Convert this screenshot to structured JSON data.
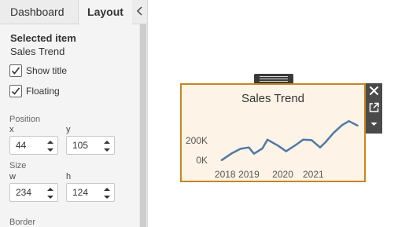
{
  "tabs": {
    "dashboard": "Dashboard",
    "layout": "Layout"
  },
  "selected": {
    "heading": "Selected item",
    "value": "Sales Trend"
  },
  "checkboxes": {
    "show_title": {
      "label": "Show title",
      "checked": true
    },
    "floating": {
      "label": "Floating",
      "checked": true
    }
  },
  "position": {
    "label": "Position",
    "x_label": "x",
    "x_value": "44",
    "y_label": "y",
    "y_value": "105"
  },
  "size": {
    "label": "Size",
    "w_label": "w",
    "w_value": "234",
    "h_label": "h",
    "h_value": "124"
  },
  "border": {
    "label": "Border"
  },
  "worksheet": {
    "title": "Sales Trend",
    "accent_color": "#c8851f",
    "background_color": "#fdf3e7"
  },
  "icons": {
    "collapse": "chevron-left-icon",
    "close": "close-icon",
    "open": "external-link-icon",
    "menu": "caret-down-icon",
    "handle": "drag-handle-icon"
  },
  "chart_data": {
    "type": "line",
    "title": "Sales Trend",
    "x": [
      2017.9,
      2018.2,
      2018.45,
      2018.7,
      2018.85,
      2019.1,
      2019.25,
      2019.55,
      2019.8,
      2020.1,
      2020.3,
      2020.55,
      2020.8,
      2020.95,
      2021.2,
      2021.45,
      2021.65,
      2021.9
    ],
    "y": [
      0,
      70000,
      115000,
      130000,
      65000,
      120000,
      210000,
      150000,
      90000,
      160000,
      210000,
      205000,
      130000,
      180000,
      280000,
      360000,
      400000,
      355000
    ],
    "xticks": [
      "2018",
      "2019",
      "2020",
      "2021"
    ],
    "xtick_values": [
      2018,
      2018.7,
      2019.7,
      2020.6
    ],
    "yticks": [
      "0K",
      "200K"
    ],
    "ytick_values": [
      0,
      200000
    ],
    "xlim": [
      2017.6,
      2022.1
    ],
    "ylim": [
      -50000,
      450000
    ],
    "line_color": "#4e79a7",
    "grid": false
  }
}
